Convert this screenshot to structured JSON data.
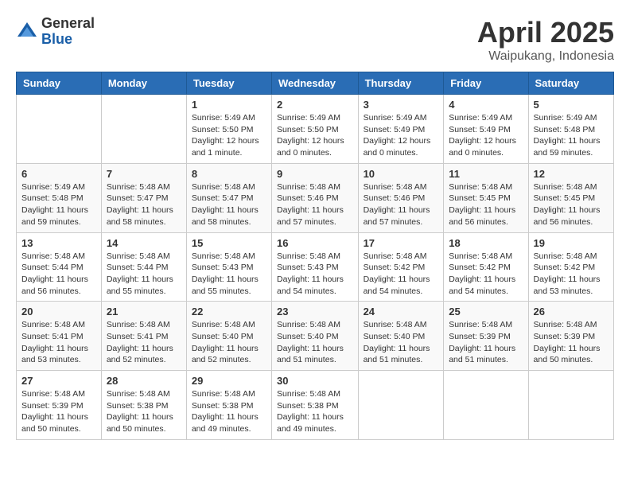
{
  "logo": {
    "general": "General",
    "blue": "Blue"
  },
  "header": {
    "month_year": "April 2025",
    "location": "Waipukang, Indonesia"
  },
  "weekdays": [
    "Sunday",
    "Monday",
    "Tuesday",
    "Wednesday",
    "Thursday",
    "Friday",
    "Saturday"
  ],
  "weeks": [
    [
      {
        "day": "",
        "info": ""
      },
      {
        "day": "",
        "info": ""
      },
      {
        "day": "1",
        "info": "Sunrise: 5:49 AM\nSunset: 5:50 PM\nDaylight: 12 hours\nand 1 minute."
      },
      {
        "day": "2",
        "info": "Sunrise: 5:49 AM\nSunset: 5:50 PM\nDaylight: 12 hours\nand 0 minutes."
      },
      {
        "day": "3",
        "info": "Sunrise: 5:49 AM\nSunset: 5:49 PM\nDaylight: 12 hours\nand 0 minutes."
      },
      {
        "day": "4",
        "info": "Sunrise: 5:49 AM\nSunset: 5:49 PM\nDaylight: 12 hours\nand 0 minutes."
      },
      {
        "day": "5",
        "info": "Sunrise: 5:49 AM\nSunset: 5:48 PM\nDaylight: 11 hours\nand 59 minutes."
      }
    ],
    [
      {
        "day": "6",
        "info": "Sunrise: 5:49 AM\nSunset: 5:48 PM\nDaylight: 11 hours\nand 59 minutes."
      },
      {
        "day": "7",
        "info": "Sunrise: 5:48 AM\nSunset: 5:47 PM\nDaylight: 11 hours\nand 58 minutes."
      },
      {
        "day": "8",
        "info": "Sunrise: 5:48 AM\nSunset: 5:47 PM\nDaylight: 11 hours\nand 58 minutes."
      },
      {
        "day": "9",
        "info": "Sunrise: 5:48 AM\nSunset: 5:46 PM\nDaylight: 11 hours\nand 57 minutes."
      },
      {
        "day": "10",
        "info": "Sunrise: 5:48 AM\nSunset: 5:46 PM\nDaylight: 11 hours\nand 57 minutes."
      },
      {
        "day": "11",
        "info": "Sunrise: 5:48 AM\nSunset: 5:45 PM\nDaylight: 11 hours\nand 56 minutes."
      },
      {
        "day": "12",
        "info": "Sunrise: 5:48 AM\nSunset: 5:45 PM\nDaylight: 11 hours\nand 56 minutes."
      }
    ],
    [
      {
        "day": "13",
        "info": "Sunrise: 5:48 AM\nSunset: 5:44 PM\nDaylight: 11 hours\nand 56 minutes."
      },
      {
        "day": "14",
        "info": "Sunrise: 5:48 AM\nSunset: 5:44 PM\nDaylight: 11 hours\nand 55 minutes."
      },
      {
        "day": "15",
        "info": "Sunrise: 5:48 AM\nSunset: 5:43 PM\nDaylight: 11 hours\nand 55 minutes."
      },
      {
        "day": "16",
        "info": "Sunrise: 5:48 AM\nSunset: 5:43 PM\nDaylight: 11 hours\nand 54 minutes."
      },
      {
        "day": "17",
        "info": "Sunrise: 5:48 AM\nSunset: 5:42 PM\nDaylight: 11 hours\nand 54 minutes."
      },
      {
        "day": "18",
        "info": "Sunrise: 5:48 AM\nSunset: 5:42 PM\nDaylight: 11 hours\nand 54 minutes."
      },
      {
        "day": "19",
        "info": "Sunrise: 5:48 AM\nSunset: 5:42 PM\nDaylight: 11 hours\nand 53 minutes."
      }
    ],
    [
      {
        "day": "20",
        "info": "Sunrise: 5:48 AM\nSunset: 5:41 PM\nDaylight: 11 hours\nand 53 minutes."
      },
      {
        "day": "21",
        "info": "Sunrise: 5:48 AM\nSunset: 5:41 PM\nDaylight: 11 hours\nand 52 minutes."
      },
      {
        "day": "22",
        "info": "Sunrise: 5:48 AM\nSunset: 5:40 PM\nDaylight: 11 hours\nand 52 minutes."
      },
      {
        "day": "23",
        "info": "Sunrise: 5:48 AM\nSunset: 5:40 PM\nDaylight: 11 hours\nand 51 minutes."
      },
      {
        "day": "24",
        "info": "Sunrise: 5:48 AM\nSunset: 5:40 PM\nDaylight: 11 hours\nand 51 minutes."
      },
      {
        "day": "25",
        "info": "Sunrise: 5:48 AM\nSunset: 5:39 PM\nDaylight: 11 hours\nand 51 minutes."
      },
      {
        "day": "26",
        "info": "Sunrise: 5:48 AM\nSunset: 5:39 PM\nDaylight: 11 hours\nand 50 minutes."
      }
    ],
    [
      {
        "day": "27",
        "info": "Sunrise: 5:48 AM\nSunset: 5:39 PM\nDaylight: 11 hours\nand 50 minutes."
      },
      {
        "day": "28",
        "info": "Sunrise: 5:48 AM\nSunset: 5:38 PM\nDaylight: 11 hours\nand 50 minutes."
      },
      {
        "day": "29",
        "info": "Sunrise: 5:48 AM\nSunset: 5:38 PM\nDaylight: 11 hours\nand 49 minutes."
      },
      {
        "day": "30",
        "info": "Sunrise: 5:48 AM\nSunset: 5:38 PM\nDaylight: 11 hours\nand 49 minutes."
      },
      {
        "day": "",
        "info": ""
      },
      {
        "day": "",
        "info": ""
      },
      {
        "day": "",
        "info": ""
      }
    ]
  ]
}
